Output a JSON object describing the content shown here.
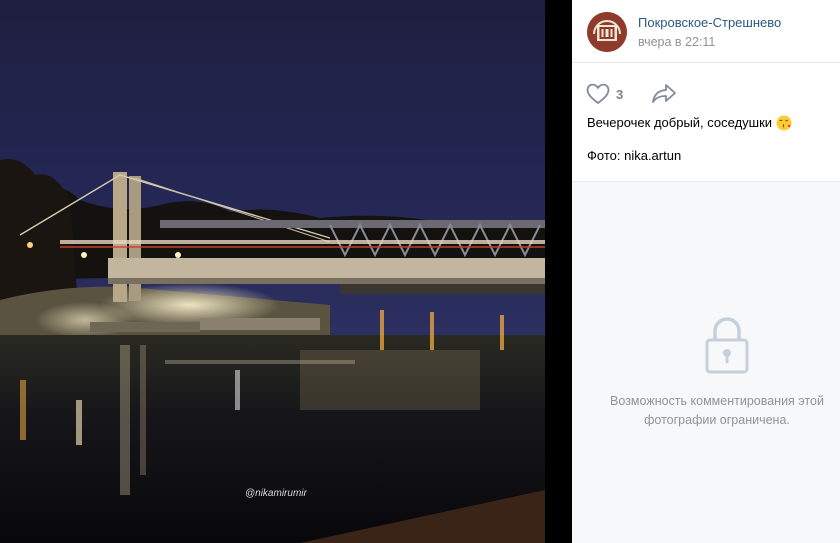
{
  "post": {
    "author": "Покровское-Стрешнево",
    "date": "вчера в 22:11",
    "likes": "3",
    "caption": "Вечерочек добрый, соседушки",
    "credit": "Фото: nika.artun"
  },
  "photo": {
    "watermark": "@nikamirumir"
  },
  "comments": {
    "restricted_text": "Возможность комментирования этой фотографии ограничена."
  },
  "icons": {
    "like": "heart-outline",
    "share": "share-arrow",
    "lock": "padlock",
    "emoji": "face-blowing-kiss"
  },
  "colors": {
    "link": "#2a5885",
    "muted": "#939393",
    "icon": "#828a99",
    "panel_bg": "#f7f8fa"
  }
}
